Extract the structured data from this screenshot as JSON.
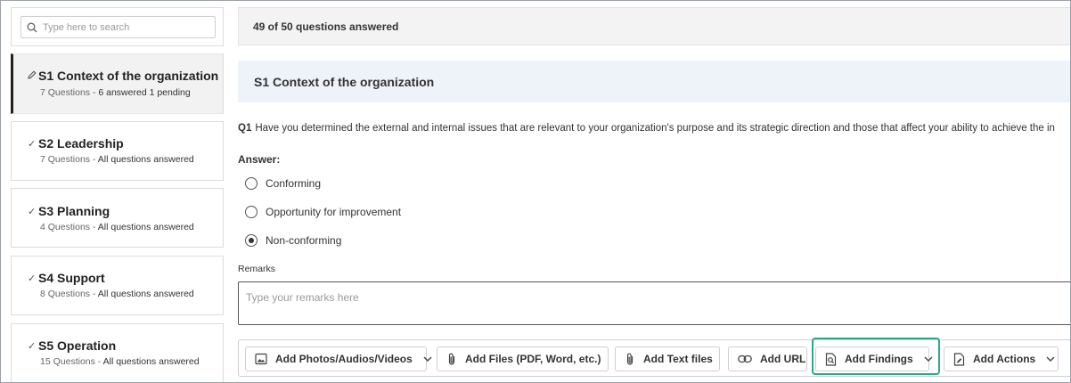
{
  "search": {
    "placeholder": "Type here to search",
    "icon": "search-icon"
  },
  "sections": [
    {
      "title": "S1 Context of the organization",
      "count": "7 Questions - ",
      "status": "6 answered 1 pending",
      "icon": "pencil-icon",
      "active": true
    },
    {
      "title": "S2 Leadership",
      "count": "7 Questions - ",
      "status": "All questions answered",
      "icon": "check-icon"
    },
    {
      "title": "S3 Planning",
      "count": "4 Questions - ",
      "status": "All questions answered",
      "icon": "check-icon"
    },
    {
      "title": "S4 Support",
      "count": "8 Questions - ",
      "status": "All questions answered",
      "icon": "check-icon"
    },
    {
      "title": "S5 Operation",
      "count": "15 Questions - ",
      "status": "All questions answered",
      "icon": "check-icon"
    }
  ],
  "main": {
    "progress": "49 of 50 questions answered",
    "section_title": "S1 Context of the organization",
    "question": {
      "number": "Q1",
      "text": "Have you determined the external and internal issues that are relevant to your organization's purpose and its strategic direction and those that affect your ability to achieve the in"
    },
    "answer_label": "Answer:",
    "options": [
      {
        "label": "Conforming",
        "selected": false
      },
      {
        "label": "Opportunity for improvement",
        "selected": false
      },
      {
        "label": "Non-conforming",
        "selected": true
      }
    ],
    "remarks_label": "Remarks",
    "remarks_placeholder": "Type your remarks here"
  },
  "toolbar": {
    "photos": "Add Photos/Audios/Videos",
    "files": "Add Files (PDF, Word, etc.)",
    "text_files": "Add Text files",
    "url": "Add URL",
    "findings": "Add Findings",
    "actions": "Add Actions"
  },
  "colors": {
    "highlight": "#2ba88a",
    "section_header_bg": "#eef3fa",
    "active_section_bg": "#f2f2f2"
  }
}
